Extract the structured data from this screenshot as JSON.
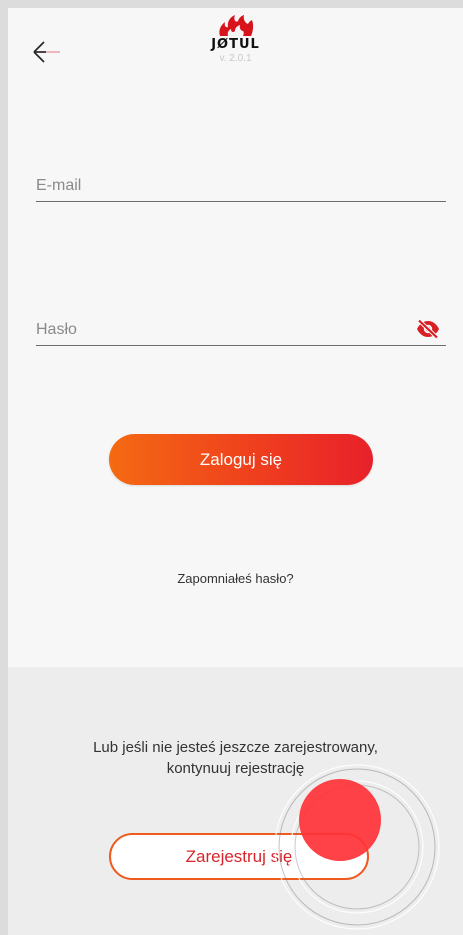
{
  "header": {
    "logo_text": "JØTUL",
    "version": "v. 2.0.1"
  },
  "form": {
    "email_placeholder": "E-mail",
    "email_value": "",
    "password_placeholder": "Hasło",
    "password_value": "",
    "login_label": "Zaloguj się",
    "forgot_label": "Zapomniałeś hasło?"
  },
  "register": {
    "hint_line1": "Lub jeśli nie jesteś jeszcze zarejestrowany,",
    "hint_line2": "kontynuuj rejestrację",
    "button_label": "Zarejestruj się"
  },
  "colors": {
    "accent": "#e8212a",
    "accent_orange": "#f46a12",
    "eye_icon": "#d91f26",
    "back_arrow_accent": "#e7a3a9"
  },
  "icons": {
    "back": "back-arrow-icon",
    "logo": "flame-logo-icon",
    "password_visibility": "eye-off-icon"
  }
}
